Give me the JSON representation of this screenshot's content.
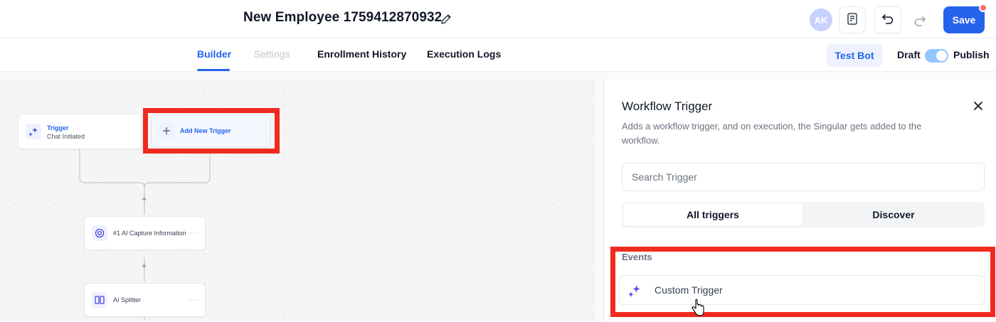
{
  "header": {
    "title": "New Employee 1759412870932",
    "avatar_initials": "AK",
    "save_label": "Save"
  },
  "tabs": [
    {
      "label": "Builder",
      "state": "active"
    },
    {
      "label": "Settings",
      "state": "disabled"
    },
    {
      "label": "Enrollment History",
      "state": "normal"
    },
    {
      "label": "Execution Logs",
      "state": "normal"
    }
  ],
  "actions": {
    "test_bot_label": "Test Bot",
    "draft_label": "Draft",
    "publish_label": "Publish",
    "publish_toggle_on": true
  },
  "canvas": {
    "trigger_node": {
      "title": "Trigger",
      "subtitle": "Chat Initiated"
    },
    "add_trigger_node": {
      "label": "Add New Trigger"
    },
    "action_nodes": [
      {
        "label": "#1 AI Capture Information",
        "icon": "target-icon"
      },
      {
        "label": "AI Splitter",
        "icon": "splitter-icon"
      }
    ]
  },
  "panel": {
    "title": "Workflow Trigger",
    "description": "Adds a workflow trigger, and on execution, the Singular gets added to the workflow.",
    "search_placeholder": "Search Trigger",
    "segments": [
      {
        "label": "All triggers",
        "active": true
      },
      {
        "label": "Discover",
        "active": false
      }
    ],
    "section_label": "Events",
    "items": [
      {
        "label": "Custom Trigger",
        "icon": "sparkle-icon"
      }
    ]
  },
  "colors": {
    "accent": "#2563eb",
    "highlight": "#f02a1f"
  }
}
